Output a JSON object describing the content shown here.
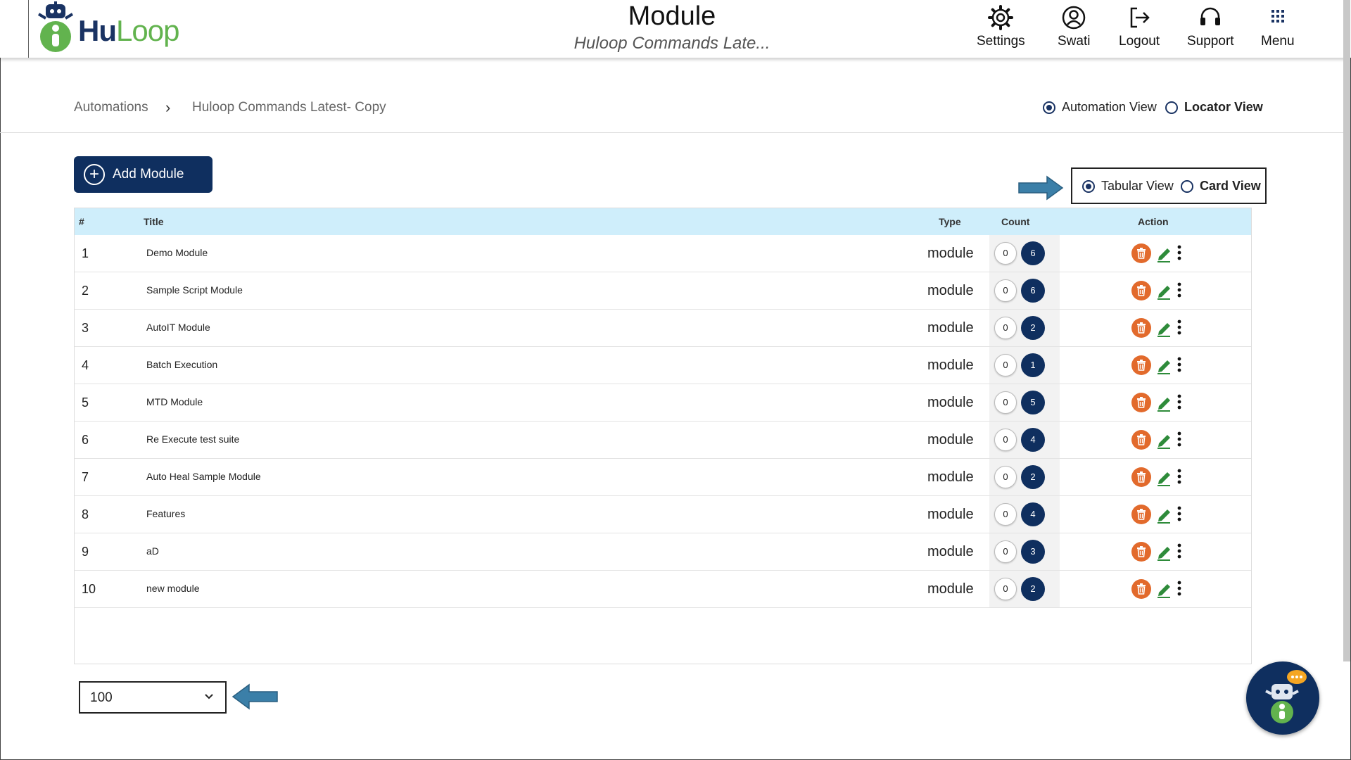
{
  "header": {
    "logo_text_hu": "Hu",
    "logo_text_loop": "Loop",
    "title": "Module",
    "subtitle": "Huloop Commands Late...",
    "nav": [
      {
        "label": "Settings",
        "icon": "gear-icon"
      },
      {
        "label": "Swati",
        "icon": "user-icon"
      },
      {
        "label": "Logout",
        "icon": "logout-icon"
      },
      {
        "label": "Support",
        "icon": "headset-icon"
      },
      {
        "label": "Menu",
        "icon": "grid-icon"
      }
    ]
  },
  "breadcrumb": {
    "items": [
      "Automations",
      "Huloop Commands Latest- Copy"
    ],
    "separator": "›"
  },
  "view_mode": {
    "options": [
      "Automation View",
      "Locator View"
    ],
    "selected": "Automation View"
  },
  "display_mode": {
    "options": [
      "Tabular View",
      "Card View"
    ],
    "selected": "Tabular View"
  },
  "add_button": {
    "label": "Add Module"
  },
  "table": {
    "headers": [
      "#",
      "Title",
      "Type",
      "Count",
      "Action"
    ],
    "rows": [
      {
        "num": "1",
        "title": "Demo Module",
        "type": "module",
        "count_a": "0",
        "count_b": "6"
      },
      {
        "num": "2",
        "title": "Sample Script Module",
        "type": "module",
        "count_a": "0",
        "count_b": "6"
      },
      {
        "num": "3",
        "title": "AutoIT Module",
        "type": "module",
        "count_a": "0",
        "count_b": "2"
      },
      {
        "num": "4",
        "title": "Batch Execution",
        "type": "module",
        "count_a": "0",
        "count_b": "1"
      },
      {
        "num": "5",
        "title": "MTD Module",
        "type": "module",
        "count_a": "0",
        "count_b": "5"
      },
      {
        "num": "6",
        "title": "Re Execute test suite",
        "type": "module",
        "count_a": "0",
        "count_b": "4"
      },
      {
        "num": "7",
        "title": "Auto Heal Sample Module",
        "type": "module",
        "count_a": "0",
        "count_b": "2"
      },
      {
        "num": "8",
        "title": "Features",
        "type": "module",
        "count_a": "0",
        "count_b": "4"
      },
      {
        "num": "9",
        "title": "aD",
        "type": "module",
        "count_a": "0",
        "count_b": "3"
      },
      {
        "num": "10",
        "title": "new module",
        "type": "module",
        "count_a": "0",
        "count_b": "2"
      }
    ]
  },
  "page_size": {
    "value": "100"
  },
  "colors": {
    "brand_dark": "#0f2f5f",
    "brand_green": "#62b34e",
    "delete": "#e26a2c",
    "edit": "#2e8b3a",
    "header_row": "#cfeefb"
  }
}
